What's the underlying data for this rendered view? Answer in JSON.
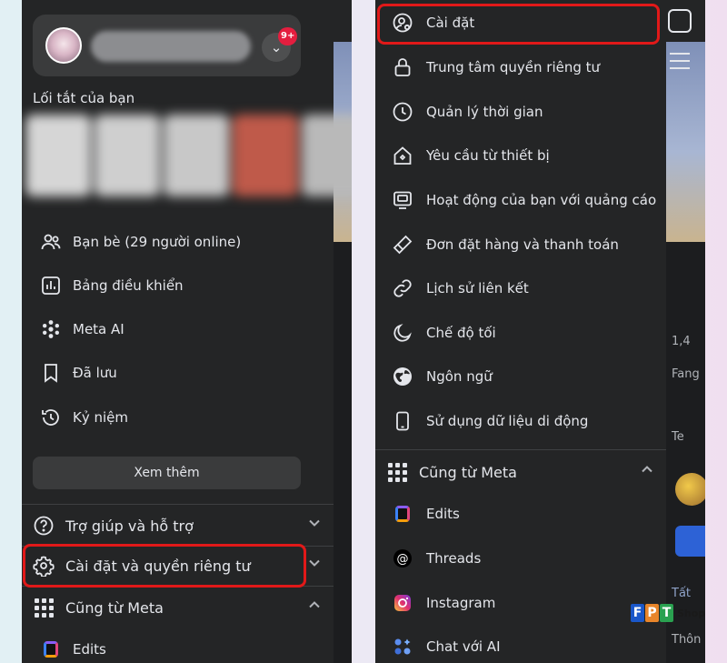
{
  "left_panel": {
    "profile": {
      "notification_badge": "9+"
    },
    "shortcuts_title": "Lối tắt của bạn",
    "items": [
      {
        "label": "Bạn bè (29 người online)",
        "icon": "friends-icon"
      },
      {
        "label": "Bảng điều khiển",
        "icon": "dashboard-icon"
      },
      {
        "label": "Meta AI",
        "icon": "meta-ai-icon"
      },
      {
        "label": "Đã lưu",
        "icon": "bookmark-icon"
      },
      {
        "label": "Kỷ niệm",
        "icon": "memories-clock-icon"
      }
    ],
    "see_more": "Xem thêm",
    "sections": [
      {
        "label": "Trợ giúp và hỗ trợ",
        "icon": "help-icon",
        "chevron": "down"
      },
      {
        "label": "Cài đặt và quyền riêng tư",
        "icon": "gear-icon",
        "chevron": "down",
        "highlighted": true
      },
      {
        "label": "Cũng từ Meta",
        "icon": "grid-icon",
        "chevron": "up"
      }
    ],
    "sub_items": [
      {
        "label": "Edits",
        "icon": "edits-icon"
      }
    ]
  },
  "right_panel": {
    "items": [
      {
        "label": "Cài đặt",
        "icon": "settings-user-icon",
        "highlighted": true
      },
      {
        "label": "Trung tâm quyền riêng tư",
        "icon": "lock-icon"
      },
      {
        "label": "Quản lý thời gian",
        "icon": "clock-icon"
      },
      {
        "label": "Yêu cầu từ thiết bị",
        "icon": "device-home-icon"
      },
      {
        "label": "Hoạt động của bạn với quảng cáo",
        "icon": "ads-activity-icon"
      },
      {
        "label": "Đơn đặt hàng và thanh toán",
        "icon": "card-tag-icon"
      },
      {
        "label": "Lịch sử liên kết",
        "icon": "link-icon"
      },
      {
        "label": "Chế độ tối",
        "icon": "moon-icon"
      },
      {
        "label": "Ngôn ngữ",
        "icon": "globe-icon"
      },
      {
        "label": "Sử dụng dữ liệu di động",
        "icon": "phone-icon"
      }
    ],
    "section": {
      "label": "Cũng từ Meta",
      "icon": "grid-icon",
      "chevron": "up"
    },
    "sub_items": [
      {
        "label": "Edits",
        "icon": "edits-icon"
      },
      {
        "label": "Threads",
        "icon": "threads-icon"
      },
      {
        "label": "Instagram",
        "icon": "instagram-icon"
      },
      {
        "label": "Chat với AI",
        "icon": "chat-ai-icon"
      }
    ]
  },
  "background_fragments": {
    "left": [],
    "right": [
      "1,4",
      "Fang",
      "Te",
      "Tất",
      "Thôn"
    ]
  },
  "watermark": {
    "letters": [
      "F",
      "P",
      "T"
    ],
    "text": "Shop"
  },
  "colors": {
    "panel": "#242526",
    "text": "#e4e6eb",
    "highlight": "#e11919",
    "badge": "#e41e3f"
  }
}
